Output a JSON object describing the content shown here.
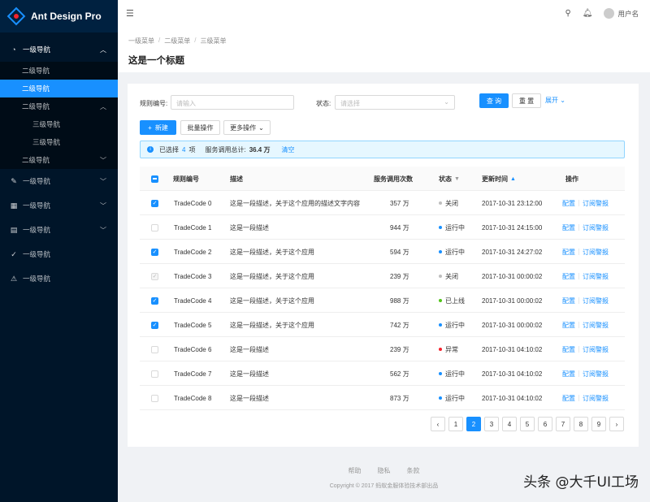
{
  "brand": {
    "title": "Ant Design Pro"
  },
  "sidebar": {
    "items": [
      {
        "level": "top",
        "label": "一级导航",
        "icon": "dashboard-icon",
        "open": true,
        "chevron": "up"
      },
      {
        "level": "sub1",
        "label": "二级导航"
      },
      {
        "level": "sub1",
        "label": "二级导航",
        "active": true
      },
      {
        "level": "sub1",
        "label": "二级导航",
        "chevron": "up"
      },
      {
        "level": "sub2",
        "label": "三级导航"
      },
      {
        "level": "sub2",
        "label": "三级导航"
      },
      {
        "level": "sub1",
        "label": "二级导航",
        "chevron": "down"
      },
      {
        "level": "top",
        "label": "一级导航",
        "icon": "form-icon",
        "chevron": "down"
      },
      {
        "level": "top",
        "label": "一级导航",
        "icon": "table-icon",
        "chevron": "down"
      },
      {
        "level": "top",
        "label": "一级导航",
        "icon": "profile-icon",
        "chevron": "down"
      },
      {
        "level": "top",
        "label": "一级导航",
        "icon": "check-circle-icon"
      },
      {
        "level": "top",
        "label": "一级导航",
        "icon": "warning-icon"
      }
    ]
  },
  "header": {
    "username": "用户名"
  },
  "breadcrumb": [
    "一级菜单",
    "二级菜单",
    "三级菜单"
  ],
  "page_title": "这是一个标题",
  "filters": {
    "rule_label": "规则编号:",
    "rule_placeholder": "请输入",
    "status_label": "状态:",
    "status_placeholder": "请选择",
    "query": "查 询",
    "reset": "重 置",
    "expand": "展开"
  },
  "toolbar": {
    "new": "新建",
    "batch": "批量操作",
    "more": "更多操作"
  },
  "alert": {
    "prefix": "已选择",
    "count": "4",
    "unit": "项",
    "total_label": "服务调用总计:",
    "total_value": "36.4 万",
    "clear": "清空"
  },
  "table": {
    "headers": {
      "rule": "规则编号",
      "desc": "描述",
      "calls": "服务调用次数",
      "status": "状态",
      "updated": "更新时间",
      "ops": "操作"
    },
    "op_config": "配置",
    "op_sub": "订阅警报",
    "rows": [
      {
        "checked": true,
        "rule": "TradeCode 0",
        "desc": "这是一段描述，关于这个应用的描述文字内容",
        "calls": "357 万",
        "status": "关闭",
        "status_color": "#bfbfbf",
        "updated": "2017-10-31  23:12:00"
      },
      {
        "checked": false,
        "rule": "TradeCode 1",
        "desc": "这是一段描述",
        "calls": "944 万",
        "status": "运行中",
        "status_color": "#1890ff",
        "updated": "2017-10-31  24:15:00"
      },
      {
        "checked": true,
        "rule": "TradeCode 2",
        "desc": "这是一段描述，关于这个应用",
        "calls": "594 万",
        "status": "运行中",
        "status_color": "#1890ff",
        "updated": "2017-10-31  24:27:02"
      },
      {
        "checked": true,
        "disabled": true,
        "rule": "TradeCode 3",
        "desc": "这是一段描述，关于这个应用",
        "calls": "239 万",
        "status": "关闭",
        "status_color": "#bfbfbf",
        "updated": "2017-10-31  00:00:02"
      },
      {
        "checked": true,
        "rule": "TradeCode 4",
        "desc": "这是一段描述，关于这个应用",
        "calls": "988 万",
        "status": "已上线",
        "status_color": "#52c41a",
        "updated": "2017-10-31  00:00:02"
      },
      {
        "checked": true,
        "rule": "TradeCode 5",
        "desc": "这是一段描述，关于这个应用",
        "calls": "742 万",
        "status": "运行中",
        "status_color": "#1890ff",
        "updated": "2017-10-31  00:00:02"
      },
      {
        "checked": false,
        "rule": "TradeCode 6",
        "desc": "这是一段描述",
        "calls": "239 万",
        "status": "异常",
        "status_color": "#f5222d",
        "updated": "2017-10-31  04:10:02"
      },
      {
        "checked": false,
        "rule": "TradeCode 7",
        "desc": "这是一段描述",
        "calls": "562 万",
        "status": "运行中",
        "status_color": "#1890ff",
        "updated": "2017-10-31  04:10:02"
      },
      {
        "checked": false,
        "rule": "TradeCode 8",
        "desc": "这是一段描述",
        "calls": "873 万",
        "status": "运行中",
        "status_color": "#1890ff",
        "updated": "2017-10-31  04:10:02"
      }
    ]
  },
  "pagination": {
    "prev": "‹",
    "next": "›",
    "pages": [
      "1",
      "2",
      "3",
      "4",
      "5",
      "6",
      "7",
      "8",
      "9"
    ],
    "current": "2"
  },
  "footer": {
    "links": [
      "帮助",
      "隐私",
      "条款"
    ],
    "copyright": "Copyright © 2017 蚂蚁金服体验技术部出品"
  },
  "watermark": "头条 @大千UI工场",
  "colors": {
    "primary": "#1890ff",
    "sider": "#001529"
  }
}
